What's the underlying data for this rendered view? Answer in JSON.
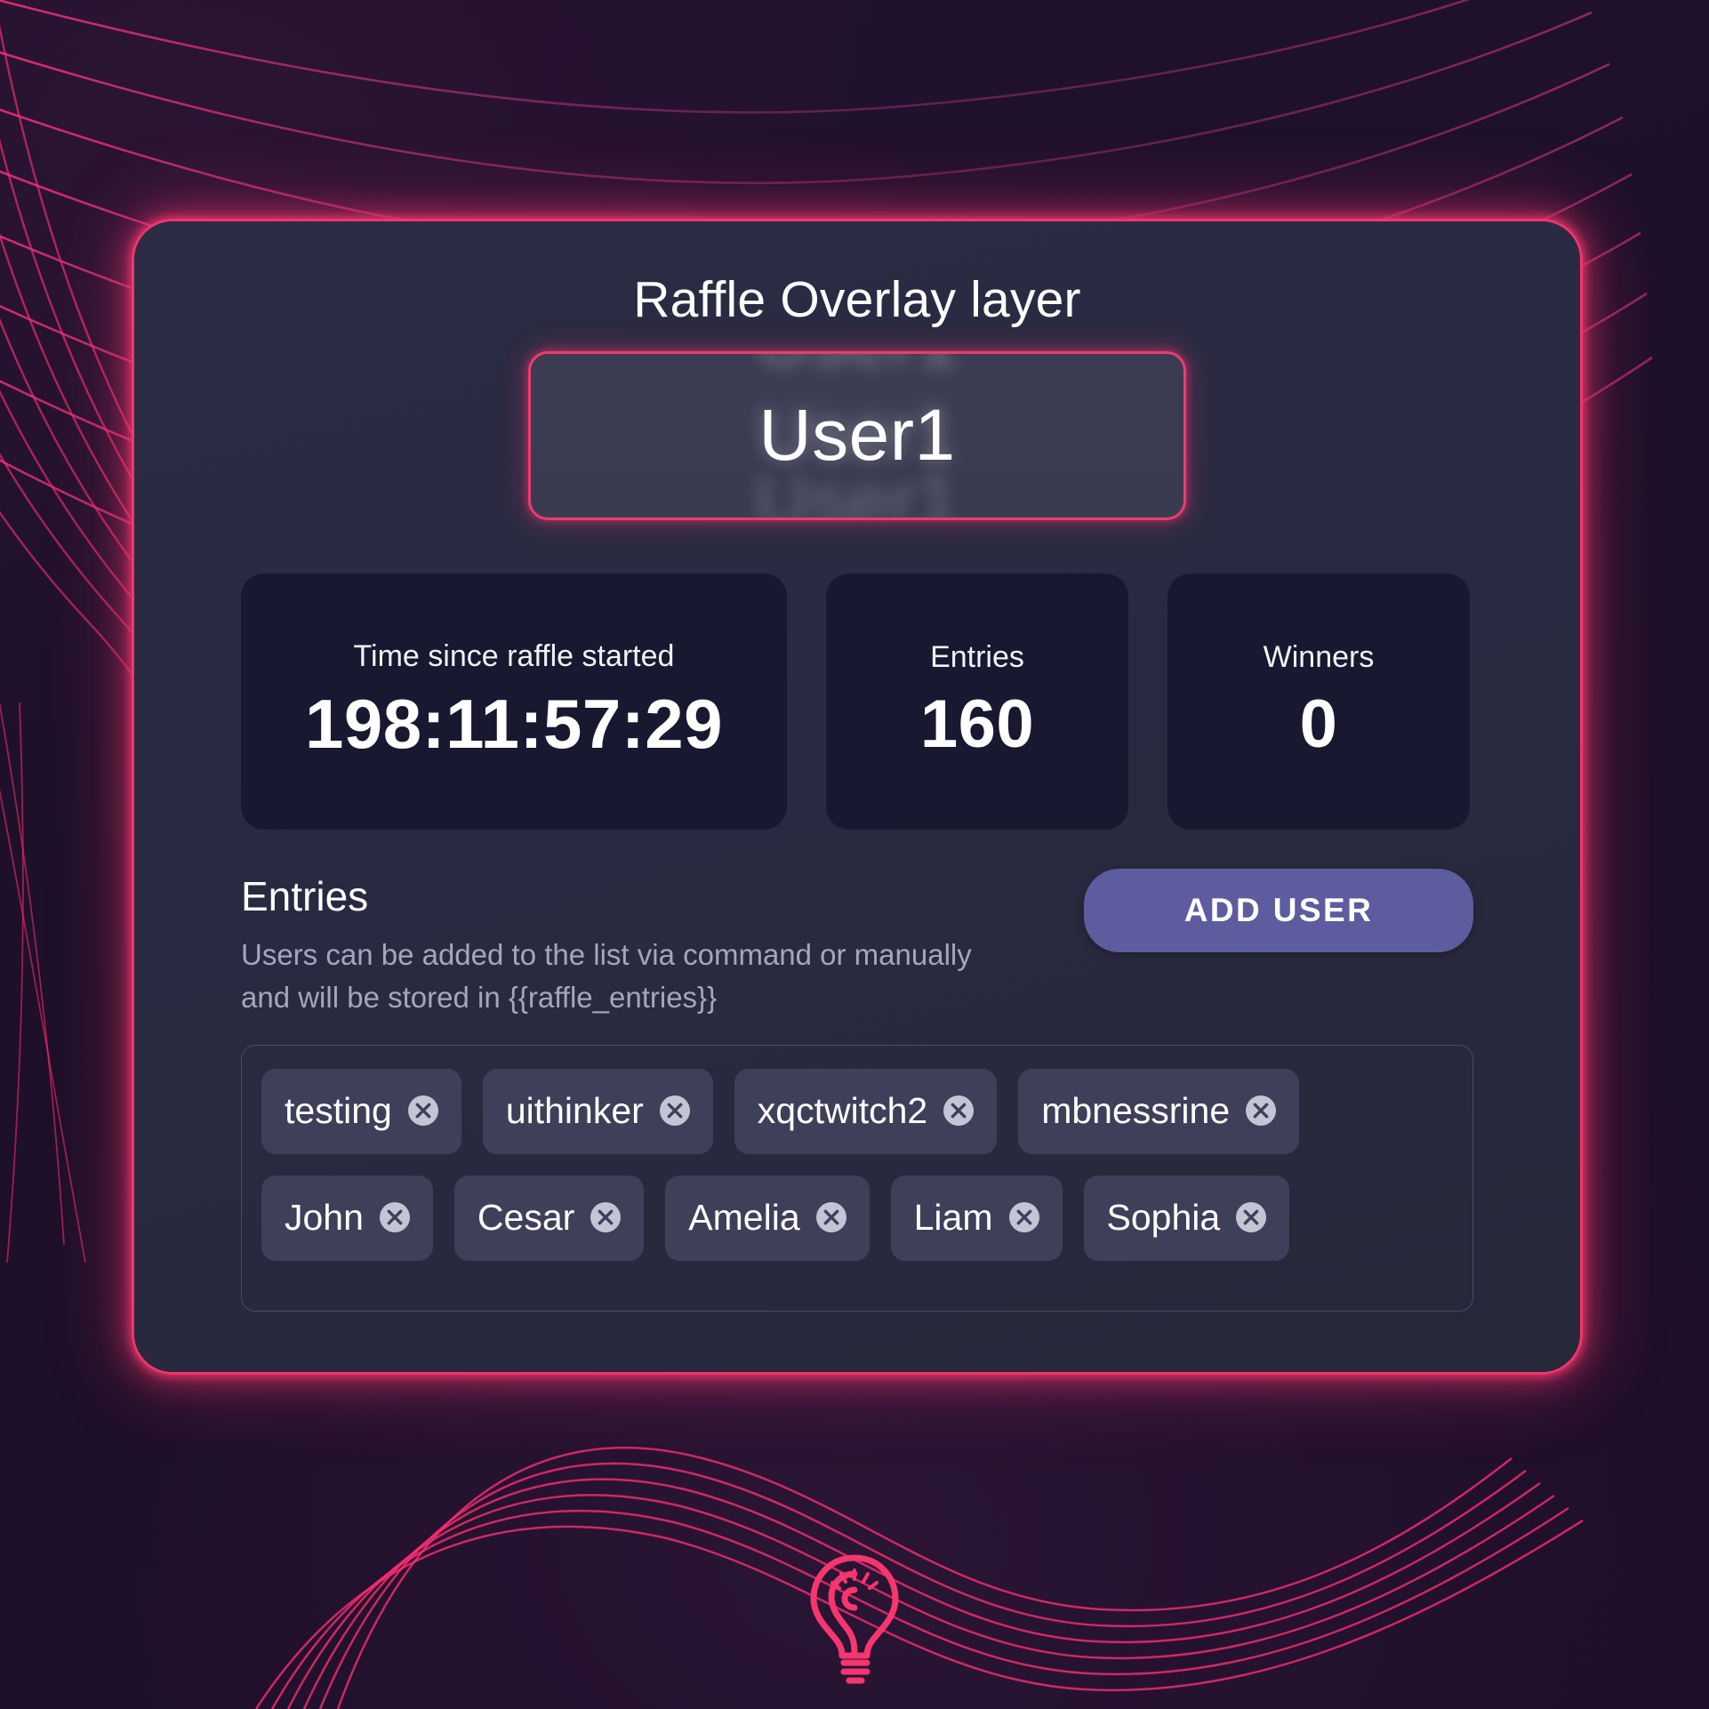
{
  "theme": {
    "accent_pink": "#f0356e",
    "button_purple": "#5d5c9e",
    "card_bg": "#2b2c44",
    "stat_card_bg": "#181830",
    "chip_bg": "#3e3f58",
    "page_bg": "#1d1028"
  },
  "header": {
    "title": "Raffle Overlay layer"
  },
  "spinner": {
    "current_name": "User1",
    "ghost_top": "User1",
    "ghost_bottom": "User1",
    "ghost_mid": "User1"
  },
  "stats": [
    {
      "label": "Time since raffle started",
      "value": "198:11:57:29",
      "size": "wide"
    },
    {
      "label": "Entries",
      "value": "160",
      "size": "narrow"
    },
    {
      "label": "Winners",
      "value": "0",
      "size": "narrow"
    }
  ],
  "entries_section": {
    "title": "Entries",
    "description": "Users can be added to the list via command or manually and will be stored in {{raffle_entries}}",
    "add_user_label": "ADD USER"
  },
  "chips": {
    "row1": [
      {
        "label": "testing",
        "remove_icon": "close-circle-icon"
      },
      {
        "label": "uithinker",
        "remove_icon": "close-circle-icon"
      },
      {
        "label": "xqctwitch2",
        "remove_icon": "close-circle-icon"
      },
      {
        "label": "mbnessrine",
        "remove_icon": "close-circle-icon"
      }
    ],
    "row2": [
      {
        "label": "John",
        "remove_icon": "close-circle-icon"
      },
      {
        "label": "Cesar",
        "remove_icon": "close-circle-icon"
      },
      {
        "label": "Amelia",
        "remove_icon": "close-circle-icon"
      },
      {
        "label": "Liam",
        "remove_icon": "close-circle-icon"
      },
      {
        "label": "Sophia",
        "remove_icon": "close-circle-icon"
      }
    ]
  },
  "branding": {
    "logo_icon": "lightbulb-icon"
  }
}
